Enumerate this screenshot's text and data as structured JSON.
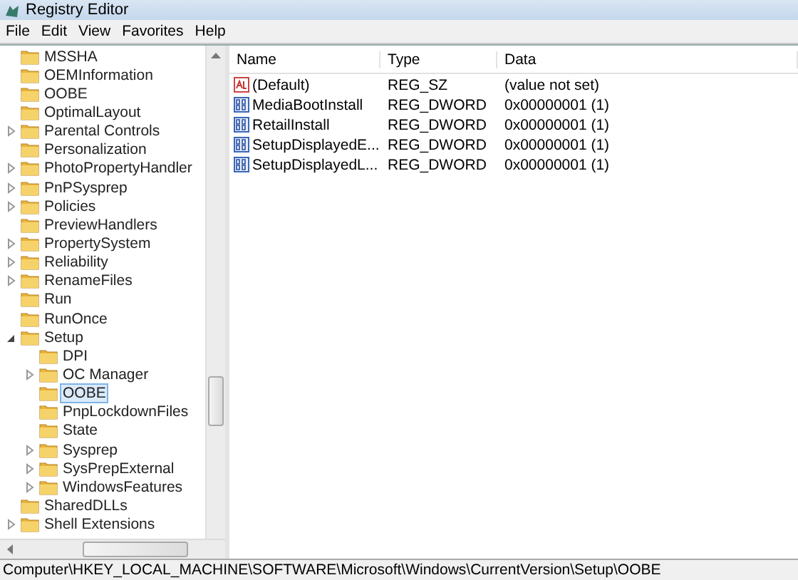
{
  "window": {
    "title": "Registry Editor"
  },
  "menu": [
    "File",
    "Edit",
    "View",
    "Favorites",
    "Help"
  ],
  "tree": [
    {
      "label": "MSSHA",
      "selected": false
    },
    {
      "label": "OEMInformation",
      "selected": false
    },
    {
      "label": "OOBE",
      "selected": false
    },
    {
      "label": "OptimalLayout",
      "selected": false
    },
    {
      "label": "Parental Controls",
      "expanded": false,
      "selected": false
    },
    {
      "label": "Personalization",
      "selected": false
    },
    {
      "label": "PhotoPropertyHandler",
      "expanded": false,
      "selected": false
    },
    {
      "label": "PnPSysprep",
      "expanded": false,
      "selected": false
    },
    {
      "label": "Policies",
      "expanded": false,
      "selected": false
    },
    {
      "label": "PreviewHandlers",
      "selected": false
    },
    {
      "label": "PropertySystem",
      "expanded": false,
      "selected": false
    },
    {
      "label": "Reliability",
      "expanded": false,
      "selected": false
    },
    {
      "label": "RenameFiles",
      "expanded": false,
      "selected": false
    },
    {
      "label": "Run",
      "selected": false
    },
    {
      "label": "RunOnce",
      "selected": false
    },
    {
      "label": "Setup",
      "expanded": true,
      "selected": false,
      "children": [
        {
          "label": "DPI",
          "selected": false
        },
        {
          "label": "OC Manager",
          "expanded": false,
          "selected": false
        },
        {
          "label": "OOBE",
          "selected": true
        },
        {
          "label": "PnpLockdownFiles",
          "selected": false
        },
        {
          "label": "State",
          "selected": false
        },
        {
          "label": "Sysprep",
          "expanded": false,
          "selected": false
        },
        {
          "label": "SysPrepExternal",
          "expanded": false,
          "selected": false
        },
        {
          "label": "WindowsFeatures",
          "expanded": false,
          "selected": false
        }
      ]
    },
    {
      "label": "SharedDLLs",
      "selected": false
    },
    {
      "label": "Shell Extensions",
      "expanded": false,
      "selected": false
    }
  ],
  "values": {
    "columns": [
      "Name",
      "Type",
      "Data"
    ],
    "rows": [
      {
        "kind": "string",
        "name": "(Default)",
        "type": "REG_SZ",
        "data": "(value not set)"
      },
      {
        "kind": "binary",
        "name": "MediaBootInstall",
        "type": "REG_DWORD",
        "data": "0x00000001 (1)"
      },
      {
        "kind": "binary",
        "name": "RetailInstall",
        "type": "REG_DWORD",
        "data": "0x00000001 (1)"
      },
      {
        "kind": "binary",
        "name": "SetupDisplayedE...",
        "type": "REG_DWORD",
        "data": "0x00000001 (1)"
      },
      {
        "kind": "binary",
        "name": "SetupDisplayedL...",
        "type": "REG_DWORD",
        "data": "0x00000001 (1)"
      }
    ]
  },
  "status_bar": "Computer\\HKEY_LOCAL_MACHINE\\SOFTWARE\\Microsoft\\Windows\\CurrentVersion\\Setup\\OOBE"
}
